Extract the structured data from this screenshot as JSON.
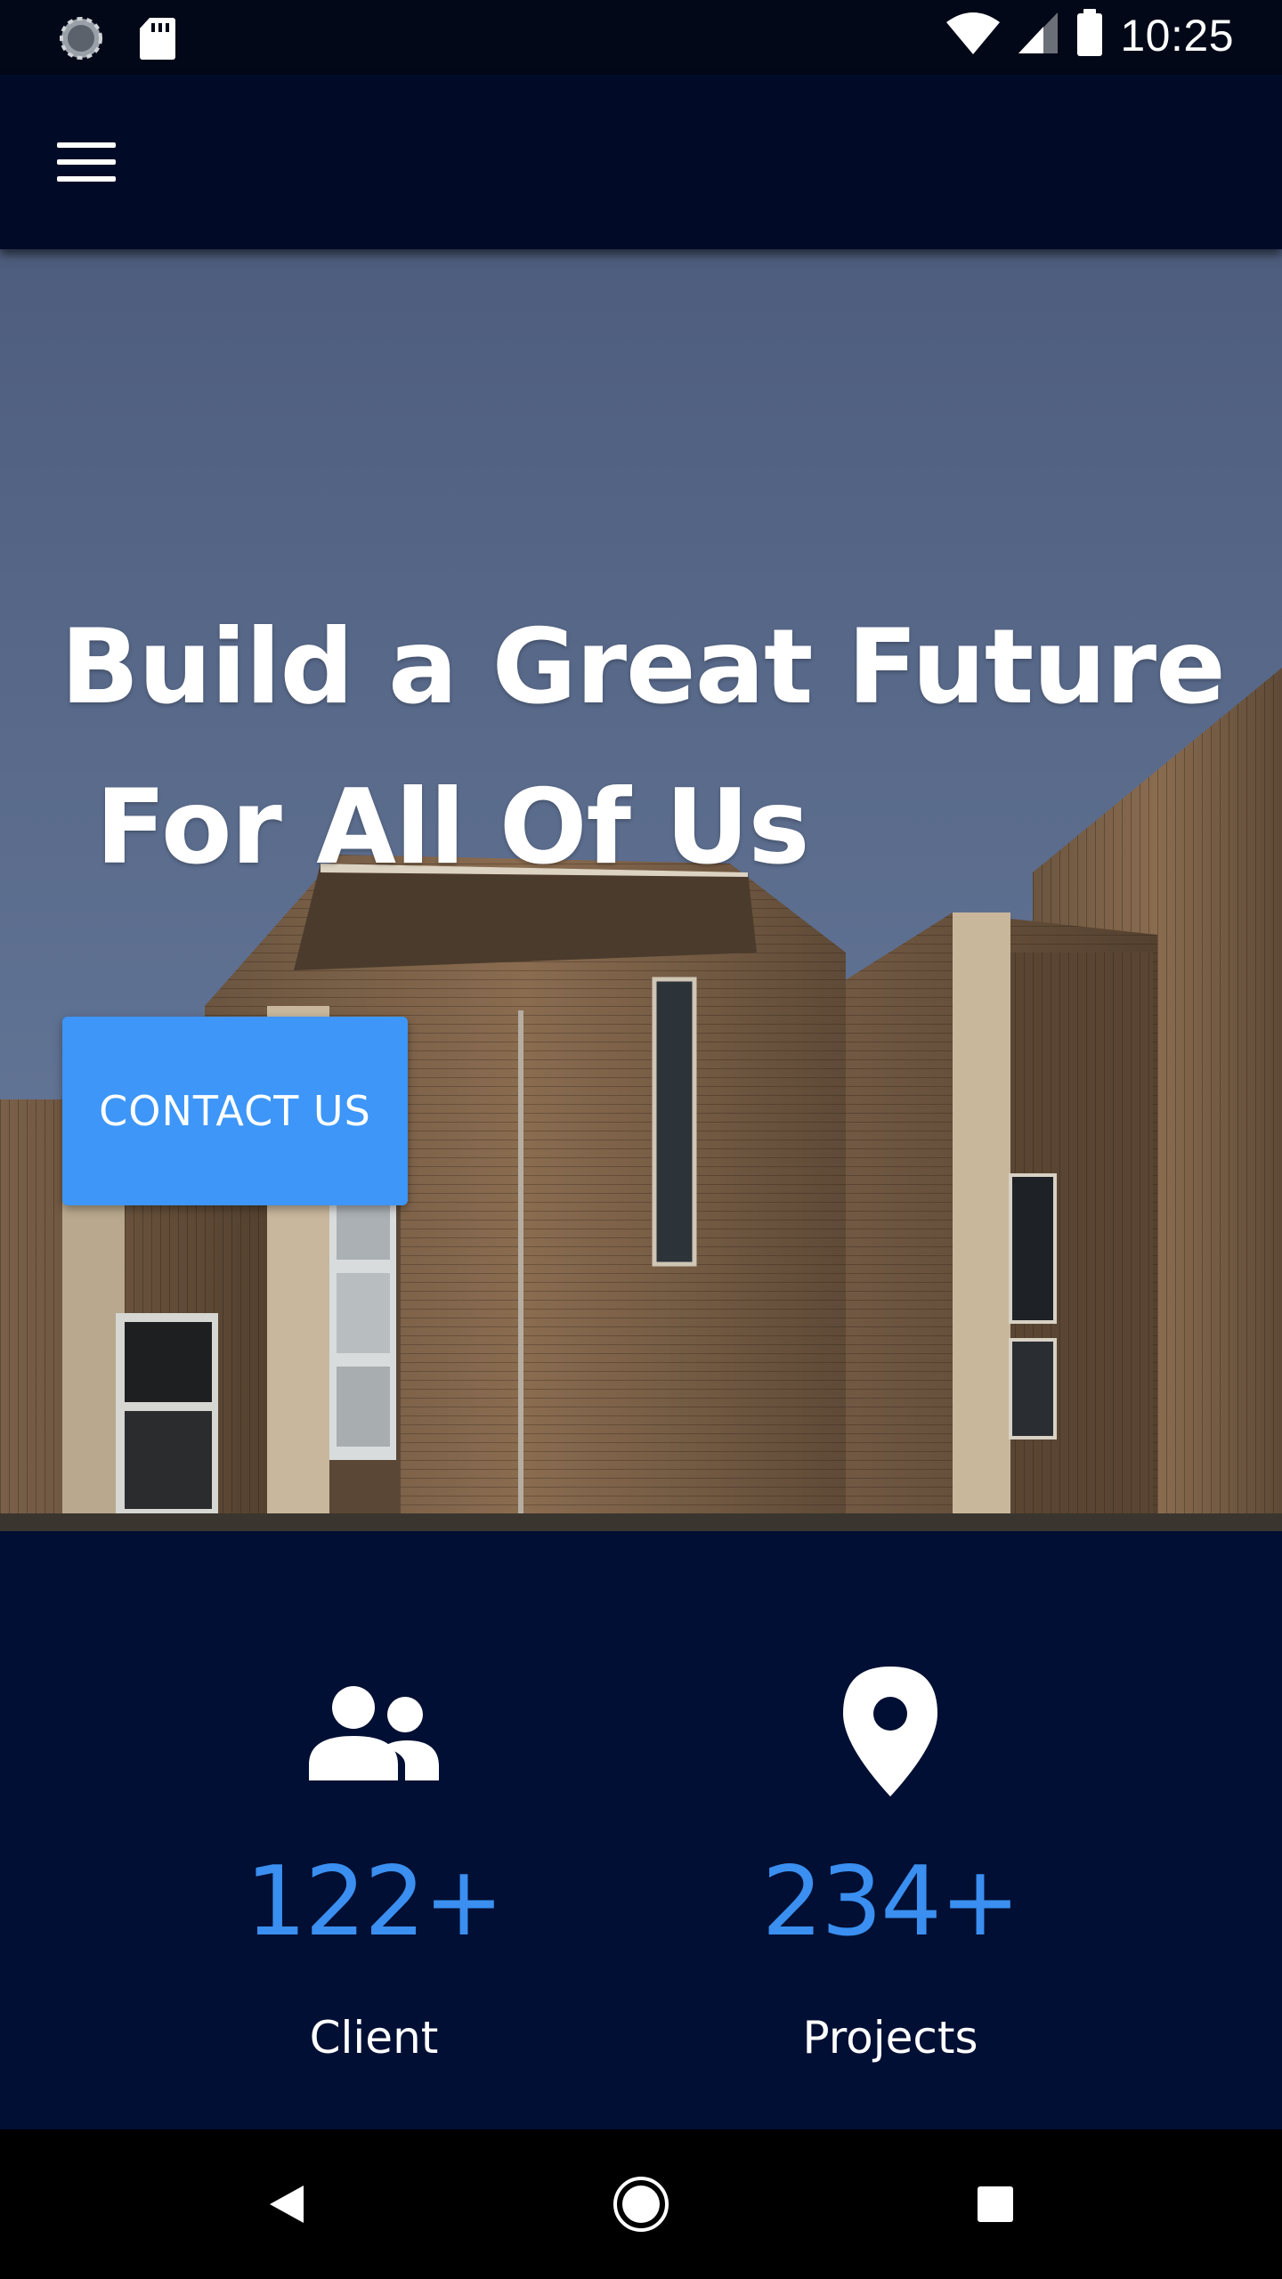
{
  "status_bar": {
    "time": "10:25",
    "icons": [
      "loading-icon",
      "sd-card-icon",
      "wifi-icon",
      "cell-signal-icon",
      "battery-icon"
    ]
  },
  "app_bar": {
    "menu_icon": "hamburger-menu-icon"
  },
  "hero": {
    "title_line1": "Build a Great Future",
    "title_line2": " For All Of Us",
    "cta_label": "CONTACT US"
  },
  "stats": [
    {
      "icon": "people-icon",
      "value": "122+",
      "label": "Client"
    },
    {
      "icon": "location-pin-icon",
      "value": "234+",
      "label": "Projects"
    }
  ],
  "nav_bar": {
    "icons": [
      "back-icon",
      "home-icon",
      "recents-icon"
    ]
  },
  "colors": {
    "accent": "#3d96f8",
    "stat_value": "#3a8ff0",
    "header_bg": "#010b28",
    "stats_bg": "#000f33"
  }
}
